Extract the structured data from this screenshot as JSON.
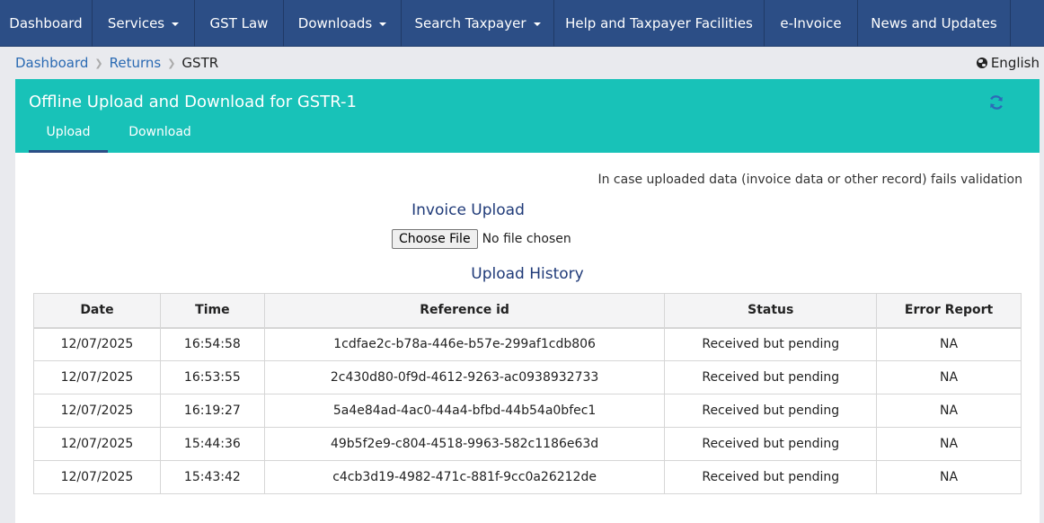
{
  "nav": {
    "items": [
      {
        "label": "Dashboard",
        "dropdown": false
      },
      {
        "label": "Services",
        "dropdown": true
      },
      {
        "label": "GST Law",
        "dropdown": false
      },
      {
        "label": "Downloads",
        "dropdown": true
      },
      {
        "label": "Search Taxpayer",
        "dropdown": true
      },
      {
        "label": "Help and Taxpayer Facilities",
        "dropdown": false
      },
      {
        "label": "e-Invoice",
        "dropdown": false
      },
      {
        "label": "News and Updates",
        "dropdown": false
      }
    ]
  },
  "breadcrumb": {
    "items": [
      "Dashboard",
      "Returns"
    ],
    "current": "GSTR"
  },
  "language": {
    "label": "English",
    "icon": "globe-icon"
  },
  "panel": {
    "title": "Offline Upload and Download for GSTR-1",
    "refresh_icon": "refresh-icon",
    "tabs": [
      {
        "label": "Upload",
        "active": true
      },
      {
        "label": "Download",
        "active": false
      }
    ]
  },
  "upload": {
    "note": "In case uploaded data (invoice data or other record) fails validation",
    "invoice_title": "Invoice Upload",
    "choose_label": "Choose File",
    "file_status": "No file chosen"
  },
  "history": {
    "title": "Upload History",
    "columns": [
      "Date",
      "Time",
      "Reference id",
      "Status",
      "Error Report"
    ],
    "rows": [
      {
        "date": "12/07/2025",
        "time": "16:54:58",
        "ref": "1cdfae2c-b78a-446e-b57e-299af1cdb806",
        "status": "Received but pending",
        "error": "NA"
      },
      {
        "date": "12/07/2025",
        "time": "16:53:55",
        "ref": "2c430d80-0f9d-4612-9263-ac0938932733",
        "status": "Received but pending",
        "error": "NA"
      },
      {
        "date": "12/07/2025",
        "time": "16:19:27",
        "ref": "5a4e84ad-4ac0-44a4-bfbd-44b54a0bfec1",
        "status": "Received but pending",
        "error": "NA"
      },
      {
        "date": "12/07/2025",
        "time": "15:44:36",
        "ref": "49b5f2e9-c804-4518-9963-582c1186e63d",
        "status": "Received but pending",
        "error": "NA"
      },
      {
        "date": "12/07/2025",
        "time": "15:43:42",
        "ref": "c4cb3d19-4982-471c-881f-9cc0a26212de",
        "status": "Received but pending",
        "error": "NA"
      }
    ]
  },
  "colors": {
    "nav_bg": "#2c4e86",
    "panel_header": "#18c2b8",
    "title_blue": "#1f3a78",
    "link_blue": "#2a6ab3"
  }
}
